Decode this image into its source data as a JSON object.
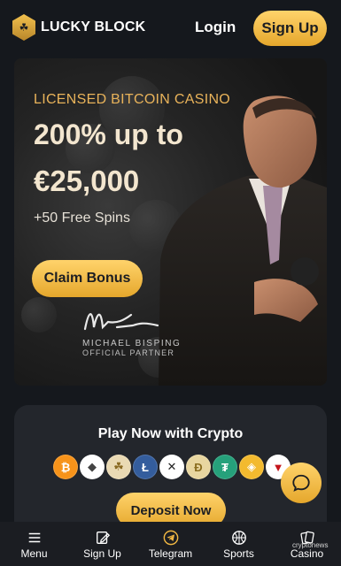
{
  "header": {
    "logo_text": "LUCKY BLOCK",
    "login_label": "Login",
    "signup_label": "Sign Up"
  },
  "hero": {
    "kicker": "LICENSED BITCOIN CASINO",
    "title_line1": "200% up to",
    "title_line2": "€25,000",
    "subtitle": "+50 Free Spins",
    "cta_label": "Claim Bonus",
    "partner_name": "MICHAEL BISPING",
    "partner_role": "OFFICIAL PARTNER"
  },
  "crypto_panel": {
    "title": "Play Now with Crypto",
    "coins": [
      {
        "name": "bitcoin-icon",
        "glyph": "₿",
        "color": "#f7931a"
      },
      {
        "name": "ethereum-icon",
        "glyph": "◆",
        "color": "#ffffff"
      },
      {
        "name": "lucky-block-icon",
        "glyph": "☘",
        "color": "#d9a441"
      },
      {
        "name": "litecoin-icon",
        "glyph": "Ł",
        "color": "#345d9d"
      },
      {
        "name": "xrp-icon",
        "glyph": "✕",
        "color": "#ffffff"
      },
      {
        "name": "dogecoin-icon",
        "glyph": "Ð",
        "color": "#c2a633"
      },
      {
        "name": "tether-icon",
        "glyph": "₮",
        "color": "#26a17b"
      },
      {
        "name": "bnb-icon",
        "glyph": "◈",
        "color": "#f3ba2f"
      },
      {
        "name": "tron-icon",
        "glyph": "▼",
        "color": "#ffffff"
      }
    ],
    "deposit_label": "Deposit Now"
  },
  "chat": {
    "icon": "chat-icon"
  },
  "bottom_nav": {
    "items": [
      {
        "label": "Menu",
        "icon": "menu-icon"
      },
      {
        "label": "Sign Up",
        "icon": "edit-icon"
      },
      {
        "label": "Telegram",
        "icon": "telegram-icon"
      },
      {
        "label": "Sports",
        "icon": "ball-icon"
      },
      {
        "label": "Casino",
        "icon": "cards-icon"
      }
    ],
    "watermark": "cryptonews"
  },
  "colors": {
    "accent": "#f2b843",
    "background": "#15181d",
    "panel": "#23262c"
  }
}
